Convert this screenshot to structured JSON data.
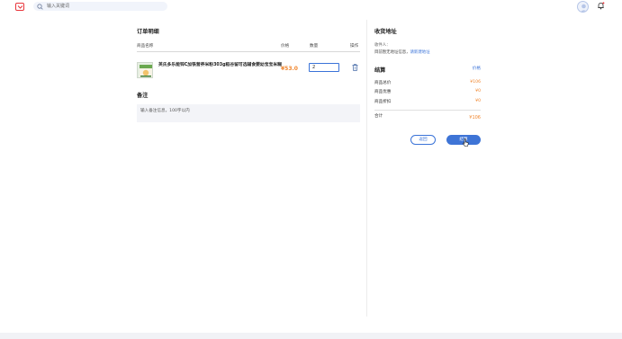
{
  "header": {
    "logo_icon": "shopping-bag-icon",
    "search_placeholder": "输入关键词",
    "avatar_icon": "user-avatar-icon",
    "bell_icon": "bell-icon"
  },
  "order": {
    "title": "订单明细",
    "columns": {
      "name": "商品名称",
      "price": "价格",
      "quantity": "数量",
      "action": "操作"
    },
    "items": [
      {
        "name": "英氏多乐能锌C加铁营养米粉303g稻谷留可选辅食婴幼宝宝米糊",
        "price": "¥53.0",
        "quantity": "2",
        "delete_icon": "trash-icon"
      }
    ]
  },
  "remark": {
    "title": "备注",
    "placeholder": "输入备注信息，100字以内"
  },
  "address": {
    "title": "收货地址",
    "recipient_label": "收件人：",
    "empty_text": "目前暂无地址信息，",
    "add_link": "请新建地址"
  },
  "settlement": {
    "title": "结算",
    "price_link": "价格",
    "lines": [
      {
        "label": "商品总价",
        "value": "¥106"
      },
      {
        "label": "商品优惠",
        "value": "¥0"
      },
      {
        "label": "商品折扣",
        "value": "¥0"
      }
    ],
    "total_label": "合计",
    "total_value": "¥106",
    "back_button": "返回",
    "pay_button": "结算"
  },
  "colors": {
    "accent": "#3e74d6",
    "price": "#f0862e",
    "brand": "#e8353b"
  }
}
